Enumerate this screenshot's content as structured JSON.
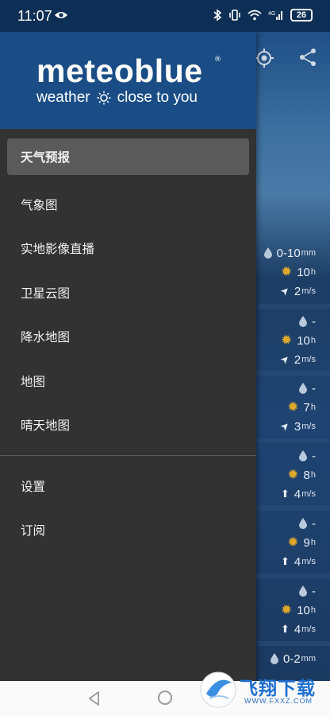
{
  "status_bar": {
    "time": "11:07",
    "battery": "26"
  },
  "drawer": {
    "logo": "meteoblue",
    "tagline_left": "weather",
    "tagline_right": "close to you",
    "items": [
      {
        "label": "天气预报",
        "active": true
      },
      {
        "label": "气象图"
      },
      {
        "label": "实地影像直播"
      },
      {
        "label": "卫星云图"
      },
      {
        "label": "降水地图"
      },
      {
        "label": "地图"
      },
      {
        "label": "晴天地图"
      }
    ],
    "secondary_items": [
      {
        "label": "设置"
      },
      {
        "label": "订阅"
      }
    ]
  },
  "forecast_rows": [
    {
      "precip": "0-10",
      "precip_unit": "mm",
      "sun": "10",
      "sun_unit": "h",
      "wind": "2",
      "wind_unit": "m/s"
    },
    {
      "precip": "-",
      "sun": "10",
      "sun_unit": "h",
      "wind": "2",
      "wind_unit": "m/s"
    },
    {
      "precip": "-",
      "sun": "7",
      "sun_unit": "h",
      "wind": "3",
      "wind_unit": "m/s"
    },
    {
      "precip": "-",
      "sun": "8",
      "sun_unit": "h",
      "wind": "4",
      "wind_unit": "m/s"
    },
    {
      "precip": "-",
      "sun": "9",
      "sun_unit": "h",
      "wind": "4",
      "wind_unit": "m/s"
    },
    {
      "precip": "-",
      "sun": "10",
      "sun_unit": "h",
      "wind": "4",
      "wind_unit": "m/s"
    },
    {
      "precip": "0-2",
      "precip_unit": "mm"
    }
  ],
  "watermark": {
    "text": "飞翔下载",
    "url": "WWW.FXXZ.COM"
  },
  "colors": {
    "drawer_bg": "#323232",
    "header_bg": "#1a4d86",
    "active_item_bg": "#5a5a5a",
    "sun_icon": "#e0a92a"
  },
  "icons": [
    "eye-icon",
    "bluetooth-icon",
    "vibrate-icon",
    "wifi-icon",
    "signal-icon",
    "target-icon",
    "share-icon",
    "raindrop-icon",
    "sun-icon",
    "wind-arrow-icon"
  ]
}
